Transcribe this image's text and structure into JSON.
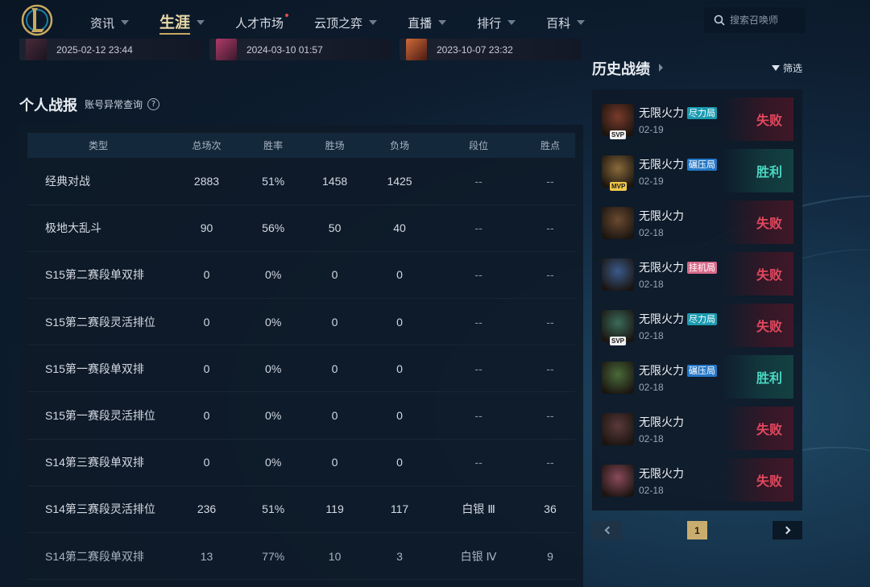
{
  "nav": {
    "logo_icon": "lol-logo-icon",
    "items": [
      {
        "label": "资讯",
        "dropdown": true,
        "active": false,
        "dot": false
      },
      {
        "label": "生涯",
        "dropdown": true,
        "active": true,
        "dot": false
      },
      {
        "label": "人才市场",
        "dropdown": false,
        "active": false,
        "dot": true
      },
      {
        "label": "云顶之弈",
        "dropdown": true,
        "active": false,
        "dot": false
      },
      {
        "label": "直播",
        "dropdown": true,
        "active": false,
        "dot": false
      },
      {
        "label": "排行",
        "dropdown": true,
        "active": false,
        "dot": false
      },
      {
        "label": "百科",
        "dropdown": true,
        "active": false,
        "dot": false
      }
    ],
    "search_placeholder": "搜索召唤师"
  },
  "video_cards": [
    {
      "time": "2025-02-12 23:44"
    },
    {
      "time": "2024-03-10 01:57"
    },
    {
      "time": "2023-10-07 23:32"
    }
  ],
  "personal": {
    "title": "个人战报",
    "link": "账号异常查询",
    "help": "?"
  },
  "stats": {
    "headers": [
      "类型",
      "总场次",
      "胜率",
      "胜场",
      "负场",
      "段位",
      "胜点"
    ],
    "rows": [
      [
        "经典对战",
        "2883",
        "51%",
        "1458",
        "1425",
        "--",
        "--"
      ],
      [
        "极地大乱斗",
        "90",
        "56%",
        "50",
        "40",
        "--",
        "--"
      ],
      [
        "S15第二赛段单双排",
        "0",
        "0%",
        "0",
        "0",
        "--",
        "--"
      ],
      [
        "S15第二赛段灵活排位",
        "0",
        "0%",
        "0",
        "0",
        "--",
        "--"
      ],
      [
        "S15第一赛段单双排",
        "0",
        "0%",
        "0",
        "0",
        "--",
        "--"
      ],
      [
        "S15第一赛段灵活排位",
        "0",
        "0%",
        "0",
        "0",
        "--",
        "--"
      ],
      [
        "S14第三赛段单双排",
        "0",
        "0%",
        "0",
        "0",
        "--",
        "--"
      ],
      [
        "S14第三赛段灵活排位",
        "236",
        "51%",
        "119",
        "117",
        "白银 Ⅲ",
        "36"
      ],
      [
        "S14第二赛段单双排",
        "13",
        "77%",
        "10",
        "3",
        "白银 Ⅳ",
        "9"
      ]
    ]
  },
  "history": {
    "title": "历史战绩",
    "filter": "筛选",
    "matches": [
      {
        "mode": "无限火力",
        "tag": "尽力局",
        "tag_type": "try",
        "date": "02-19",
        "result": "失败",
        "win": false,
        "medal": "SVP",
        "avatar_color": "#7a3b2a"
      },
      {
        "mode": "无限火力",
        "tag": "碾压局",
        "tag_type": "crush",
        "date": "02-19",
        "result": "胜利",
        "win": true,
        "medal": "MVP",
        "avatar_color": "#8a6a3a"
      },
      {
        "mode": "无限火力",
        "tag": "",
        "tag_type": "",
        "date": "02-18",
        "result": "失败",
        "win": false,
        "medal": "",
        "avatar_color": "#6a4a30"
      },
      {
        "mode": "无限火力",
        "tag": "挂机局",
        "tag_type": "afk",
        "date": "02-18",
        "result": "失败",
        "win": false,
        "medal": "",
        "avatar_color": "#3a5a8a"
      },
      {
        "mode": "无限火力",
        "tag": "尽力局",
        "tag_type": "try",
        "date": "02-18",
        "result": "失败",
        "win": false,
        "medal": "SVP",
        "avatar_color": "#3a6a5a"
      },
      {
        "mode": "无限火力",
        "tag": "碾压局",
        "tag_type": "crush",
        "date": "02-18",
        "result": "胜利",
        "win": true,
        "medal": "",
        "avatar_color": "#4a6a3a"
      },
      {
        "mode": "无限火力",
        "tag": "",
        "tag_type": "",
        "date": "02-18",
        "result": "失败",
        "win": false,
        "medal": "",
        "avatar_color": "#5a3a3a"
      },
      {
        "mode": "无限火力",
        "tag": "",
        "tag_type": "",
        "date": "02-18",
        "result": "失败",
        "win": false,
        "medal": "",
        "avatar_color": "#8a4a5a"
      }
    ]
  },
  "pager": {
    "current": "1"
  }
}
